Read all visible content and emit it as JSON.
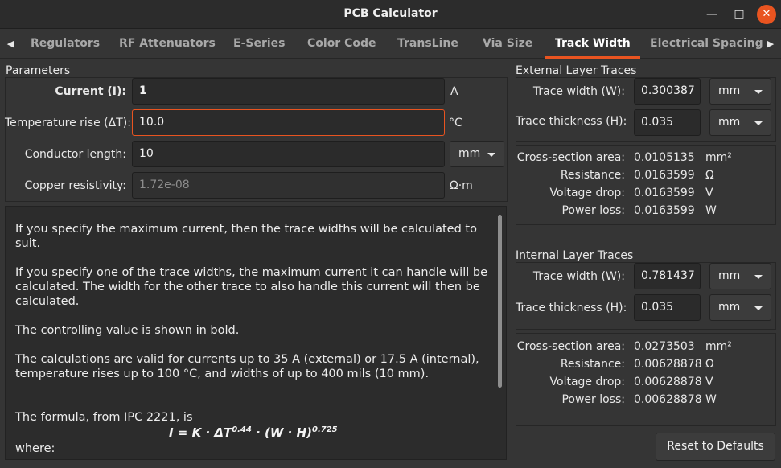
{
  "window": {
    "title": "PCB Calculator"
  },
  "tabs": [
    "Regulators",
    "RF Attenuators",
    "E-Series",
    "Color Code",
    "TransLine",
    "Via Size",
    "Track Width",
    "Electrical Spacing"
  ],
  "active_tab": "Track Width",
  "parameters": {
    "title": "Parameters",
    "current_label": "Current (I):",
    "current_value": "1",
    "current_unit": "A",
    "temp_label": "Temperature rise (ΔT):",
    "temp_value": "10.0",
    "temp_unit": "°C",
    "length_label": "Conductor length:",
    "length_value": "10",
    "length_unit": "mm",
    "resistivity_label": "Copper resistivity:",
    "resistivity_value": "1.72e-08",
    "resistivity_unit": "Ω·m"
  },
  "help": {
    "p1": "If you specify the maximum current, then the trace widths will be calculated to suit.",
    "p2": "If you specify one of the trace widths, the maximum current it can handle will be calculated. The width for the other trace to also handle this current will then be calculated.",
    "p3": "The controlling value is shown in bold.",
    "p4": "The calculations are valid for currents up to 35 A (external) or 17.5 A (internal), temperature rises up to 100 °C, and widths of up to 400 mils (10 mm).",
    "p5": "The formula, from IPC 2221, is",
    "formula_main": "I = K · ΔT",
    "formula_exp1": "0.44",
    "formula_mid": " · (W · H)",
    "formula_exp2": "0.725",
    "p6": "where:"
  },
  "external": {
    "title": "External Layer Traces",
    "width_label": "Trace width (W):",
    "width_value": "0.300387",
    "width_unit": "mm",
    "thickness_label": "Trace thickness (H):",
    "thickness_value": "0.035",
    "thickness_unit": "mm",
    "area_label": "Cross-section area:",
    "area_value": "0.0105135",
    "area_unit": "mm²",
    "resistance_label": "Resistance:",
    "resistance_value": "0.0163599",
    "resistance_unit": "Ω",
    "vdrop_label": "Voltage drop:",
    "vdrop_value": "0.0163599",
    "vdrop_unit": "V",
    "ploss_label": "Power loss:",
    "ploss_value": "0.0163599",
    "ploss_unit": "W"
  },
  "internal": {
    "title": "Internal Layer Traces",
    "width_label": "Trace width (W):",
    "width_value": "0.781437",
    "width_unit": "mm",
    "thickness_label": "Trace thickness (H):",
    "thickness_value": "0.035",
    "thickness_unit": "mm",
    "area_label": "Cross-section area:",
    "area_value": "0.0273503",
    "area_unit": "mm²",
    "resistance_label": "Resistance:",
    "resistance_value": "0.00628878",
    "resistance_unit": "Ω",
    "vdrop_label": "Voltage drop:",
    "vdrop_value": "0.00628878",
    "vdrop_unit": "V",
    "ploss_label": "Power loss:",
    "ploss_value": "0.00628878",
    "ploss_unit": "W"
  },
  "reset_label": "Reset to Defaults",
  "colors": {
    "accent": "#e95420",
    "background": "#353535"
  }
}
